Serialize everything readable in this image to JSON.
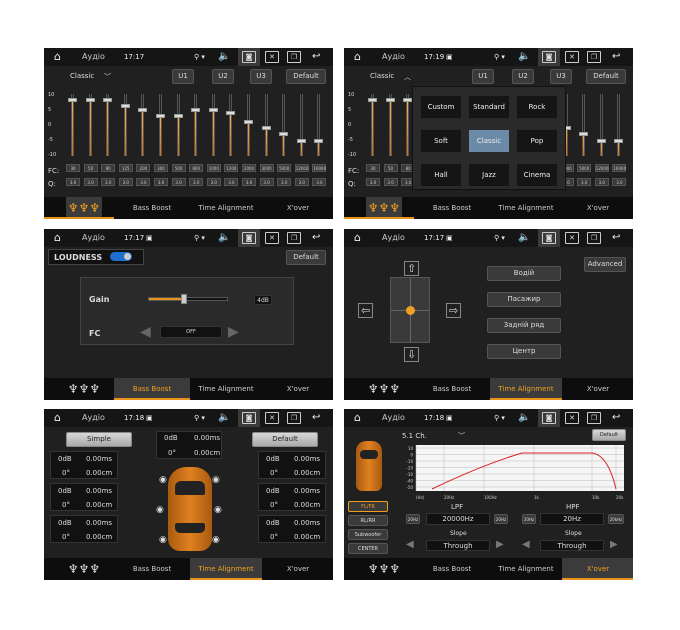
{
  "status": {
    "title": "Аудіо",
    "panel1_time": "17:17",
    "panel2_time": "17:19",
    "panel3_time": "17:17",
    "panel4_time": "17:17",
    "panel5_time": "17:18",
    "panel6_time": "17:18"
  },
  "tabs": {
    "eq": "EQ",
    "bass": "Bass Boost",
    "time": "Time Alignment",
    "xover": "X'over"
  },
  "eq": {
    "preset_label": "Classic",
    "u1": "U1",
    "u2": "U2",
    "u3": "U3",
    "default": "Default",
    "scale": [
      "10",
      "5",
      "0",
      "-5",
      "-10"
    ],
    "fc_label": "FC:",
    "q_label": "Q:",
    "freqs": [
      "30",
      "50",
      "80",
      "125",
      "200",
      "300",
      "500",
      "800",
      "1000",
      "1200",
      "2000",
      "3000",
      "5000",
      "12000",
      "16000"
    ],
    "q": [
      "3.0",
      "3.0",
      "3.0",
      "3.0",
      "3.0",
      "3.0",
      "3.0",
      "3.0",
      "3.0",
      "3.0",
      "3.0",
      "3.0",
      "3.0",
      "3.0",
      "3.0"
    ],
    "levels": [
      8,
      8,
      8,
      6,
      5,
      3,
      3,
      5,
      5,
      4,
      1,
      -1,
      -3,
      -5,
      -5
    ],
    "presets": [
      "Custom",
      "Standard",
      "Rock",
      "Soft",
      "Classic",
      "Pop",
      "Hall",
      "Jazz",
      "Cinema"
    ],
    "selected_preset": "Classic"
  },
  "bass": {
    "loudness": "LOUDNESS",
    "default": "Default",
    "gain_label": "Gain",
    "gain_value": "4dB",
    "gain_level": 0.45,
    "fc_label": "FC",
    "fc_value": "OFF"
  },
  "balance": {
    "advanced": "Advanced",
    "seats": [
      "Водій",
      "Пасажир",
      "Задній ряд",
      "Центр"
    ]
  },
  "time": {
    "simple": "Simple",
    "default": "Default",
    "center_db": "0dB",
    "center_ms": "0.00ms",
    "center_deg": "0°",
    "center_cm": "0.00cm",
    "cells": [
      {
        "db": "0dB",
        "ms": "0.00ms",
        "deg": "0°",
        "cm": "0.00cm"
      },
      {
        "db": "0dB",
        "ms": "0.00ms",
        "deg": "0°",
        "cm": "0.00cm"
      },
      {
        "db": "0dB",
        "ms": "0.00ms",
        "deg": "0°",
        "cm": "0.00cm"
      },
      {
        "db": "0dB",
        "ms": "0.00ms",
        "deg": "0°",
        "cm": "0.00cm"
      },
      {
        "db": "0dB",
        "ms": "0.00ms",
        "deg": "0°",
        "cm": "0.00cm"
      },
      {
        "db": "0dB",
        "ms": "0.00ms",
        "deg": "0°",
        "cm": "0.00cm"
      }
    ]
  },
  "xover": {
    "channel": "5.1 Ch.",
    "default": "Default",
    "y_ticks": [
      "10",
      "0",
      "-10",
      "-20",
      "-30",
      "-40",
      "-50"
    ],
    "x_ticks": [
      "(Hz)",
      "20Hz",
      "100Hz",
      "1k",
      "10k",
      "20k"
    ],
    "buttons": [
      "FL/FR",
      "RL/RR",
      "Subwoofer",
      "CENTER"
    ],
    "lpf": "LPF",
    "hpf": "HPF",
    "lpf_value": "20000Hz",
    "hpf_value": "20Hz",
    "lpf_left": "20Hz",
    "lpf_right": "20Hz",
    "hpf_left": "20Hz",
    "hpf_right": "20kHz",
    "slope": "Slope",
    "lpf_slope": "Through",
    "hpf_slope": "Through"
  },
  "colors": {
    "accent": "#e8941a",
    "selected_preset": "#6a8aa8"
  }
}
